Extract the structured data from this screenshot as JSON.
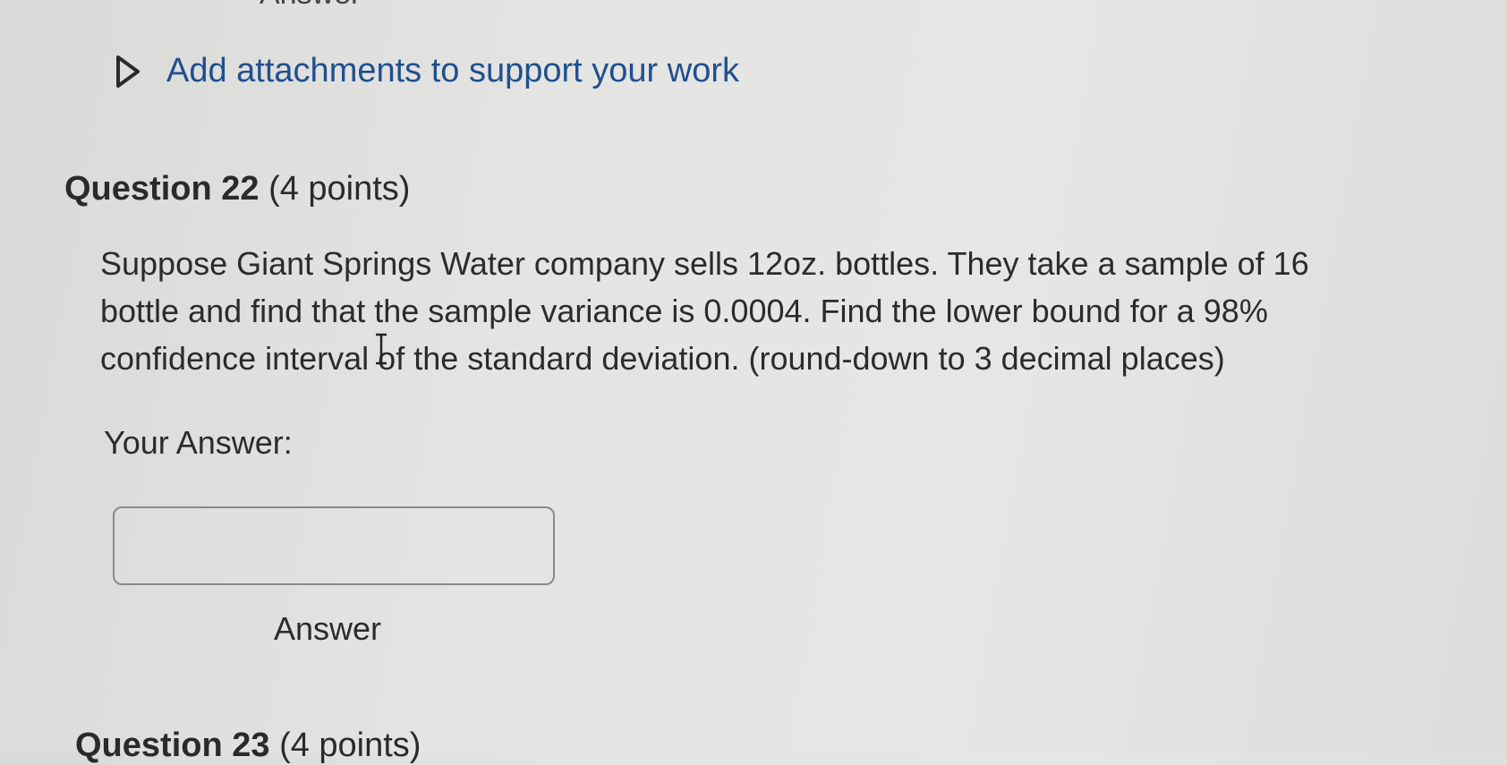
{
  "top_clipped_text": "Answer",
  "attachments": {
    "label": "Add attachments to support your work",
    "icon": "caret-right-icon",
    "link_color": "#1f4f8f"
  },
  "question": {
    "title": "Question 22",
    "points": "(4 points)",
    "body_lines": [
      "Suppose Giant Springs Water company sells 12oz. bottles. They take a sample of 16",
      "bottle and find that the sample variance is 0.0004. Find the lower bound for a 98%",
      "confidence interval of the standard deviation. (round-down to 3 decimal places)"
    ]
  },
  "answer": {
    "prompt": "Your Answer:",
    "value": "",
    "placeholder": "",
    "field_label": "Answer"
  },
  "next_question": {
    "title": "Question 23",
    "points": "(4 points)"
  }
}
